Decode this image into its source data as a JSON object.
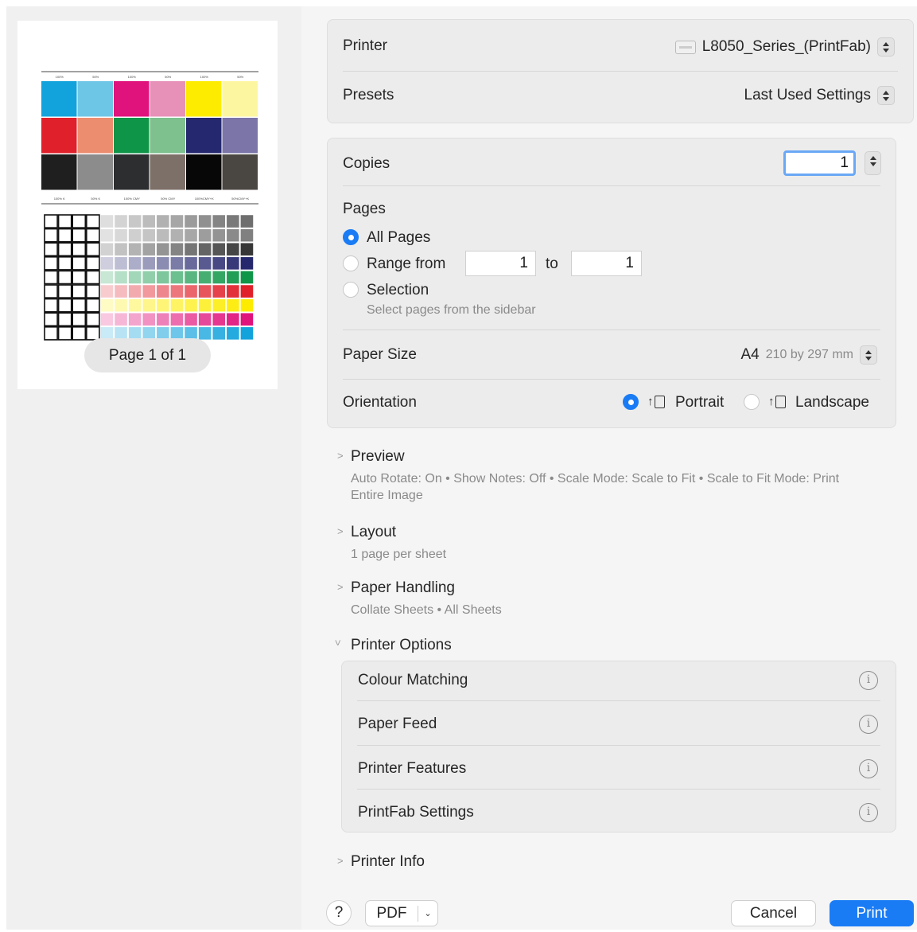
{
  "preview": {
    "page_indicator": "Page 1 of 1",
    "chart_top_labels": [
      "100%",
      "50%",
      "100%",
      "50%",
      "100%",
      "50%"
    ],
    "chart_bottom_labels": [
      "100% K",
      "50% K",
      "100% CMY",
      "50% CMY",
      "100%CMY+K",
      "50%CMY+K"
    ],
    "swatch_rows": [
      [
        "#12a3dc",
        "#6ec6e6",
        "#e0127c",
        "#e891b8",
        "#fdec00",
        "#fdf6a0"
      ],
      [
        "#e0202a",
        "#ec8d70",
        "#0f9548",
        "#7ec08e",
        "#26286f",
        "#7b75a8"
      ],
      [
        "#1f1f1f",
        "#8c8c8c",
        "#2c2e30",
        "#7d7068",
        "#070707",
        "#4a4642"
      ]
    ]
  },
  "printer": {
    "label": "Printer",
    "value": "L8050_Series_(PrintFab)"
  },
  "presets": {
    "label": "Presets",
    "value": "Last Used Settings"
  },
  "copies": {
    "label": "Copies",
    "value": "1"
  },
  "pages": {
    "label": "Pages",
    "options": {
      "all": "All Pages",
      "range": "Range from",
      "to": "to",
      "selection": "Selection",
      "selection_hint": "Select pages from the sidebar"
    },
    "range_from": "1",
    "range_to": "1",
    "selected": "all"
  },
  "paper_size": {
    "label": "Paper Size",
    "value": "A4",
    "dimensions": "210 by 297 mm"
  },
  "orientation": {
    "label": "Orientation",
    "portrait": "Portrait",
    "landscape": "Landscape",
    "selected": "portrait"
  },
  "sections": [
    {
      "title": "Preview",
      "summary": "Auto Rotate: On • Show Notes: Off • Scale Mode: Scale to Fit • Scale to Fit Mode: Print Entire Image"
    },
    {
      "title": "Layout",
      "summary": "1 page per sheet"
    },
    {
      "title": "Paper Handling",
      "summary": "Collate Sheets • All Sheets"
    }
  ],
  "printer_options": {
    "title": "Printer Options",
    "items": [
      "Colour Matching",
      "Paper Feed",
      "Printer Features",
      "PrintFab Settings"
    ]
  },
  "printer_info": {
    "title": "Printer Info"
  },
  "footer": {
    "help": "?",
    "pdf": "PDF",
    "cancel": "Cancel",
    "print": "Print"
  },
  "colors": {
    "accent": "#1a7cf5",
    "print_button": "#1a7cf5"
  }
}
